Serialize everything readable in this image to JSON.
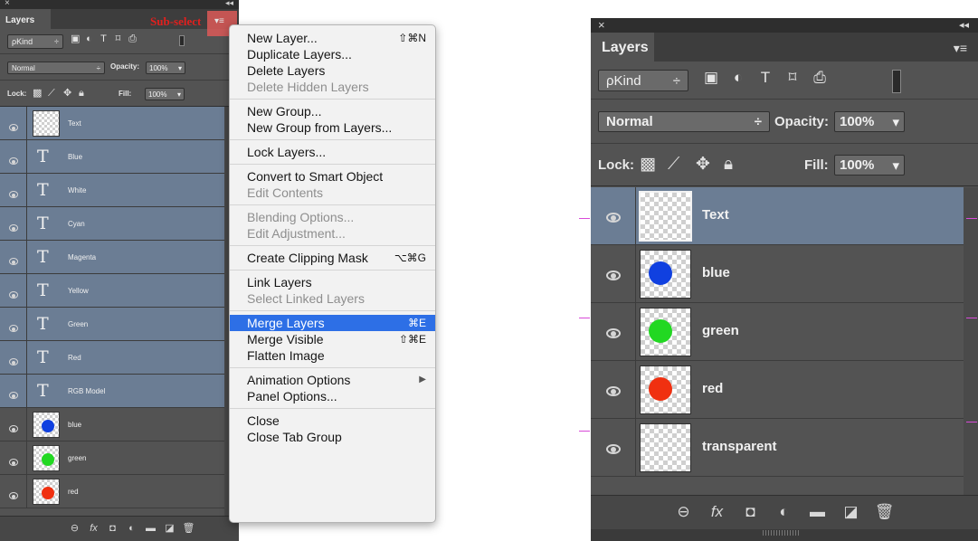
{
  "left_panel": {
    "close_glyph": "×",
    "collapse_glyph": "◂◂",
    "tab_label": "Layers",
    "annotation": "Sub-select",
    "panel_menu_glyph": "▾≡",
    "filter_kind": "ρKind",
    "filter_kind_arrow": "÷",
    "filter_icons": [
      "image-icon",
      "adjustment-icon",
      "type-icon",
      "shape-icon",
      "smart-object-icon"
    ],
    "blend_mode": "Normal",
    "blend_arrow": "÷",
    "opacity_label": "Opacity:",
    "opacity_value": "100%",
    "lock_label": "Lock:",
    "fill_label": "Fill:",
    "fill_value": "100%",
    "layers": [
      {
        "name": "Text",
        "kind": "raster",
        "selected": true
      },
      {
        "name": "Blue",
        "kind": "type",
        "selected": true
      },
      {
        "name": "White",
        "kind": "type",
        "selected": true
      },
      {
        "name": "Cyan",
        "kind": "type",
        "selected": true
      },
      {
        "name": "Magenta",
        "kind": "type",
        "selected": true
      },
      {
        "name": "Yellow",
        "kind": "type",
        "selected": true
      },
      {
        "name": "Green",
        "kind": "type",
        "selected": true
      },
      {
        "name": "Red",
        "kind": "type",
        "selected": true
      },
      {
        "name": "RGB Model",
        "kind": "type",
        "selected": true
      },
      {
        "name": "blue",
        "kind": "dot",
        "color": "#1040e0",
        "selected": false
      },
      {
        "name": "green",
        "kind": "dot",
        "color": "#22d822",
        "selected": false
      },
      {
        "name": "red",
        "kind": "dot",
        "color": "#f03010",
        "selected": false
      }
    ],
    "type_glyph": "T",
    "bottom_icons": [
      "link-icon",
      "fx-icon",
      "mask-icon",
      "adjustment-layer-icon",
      "folder-icon",
      "new-layer-icon",
      "trash-icon"
    ]
  },
  "context_menu": {
    "items": [
      {
        "label": "New Layer...",
        "shortcut": "⇧⌘N",
        "disabled": false
      },
      {
        "label": "Duplicate Layers...",
        "disabled": false
      },
      {
        "label": "Delete Layers",
        "disabled": false
      },
      {
        "label": "Delete Hidden Layers",
        "disabled": true
      },
      {
        "sep": true
      },
      {
        "label": "New Group...",
        "disabled": false
      },
      {
        "label": "New Group from Layers...",
        "disabled": false
      },
      {
        "sep": true
      },
      {
        "label": "Lock Layers...",
        "disabled": false
      },
      {
        "sep": true
      },
      {
        "label": "Convert to Smart Object",
        "disabled": false
      },
      {
        "label": "Edit Contents",
        "disabled": true
      },
      {
        "sep": true
      },
      {
        "label": "Blending Options...",
        "disabled": true
      },
      {
        "label": "Edit Adjustment...",
        "disabled": true
      },
      {
        "sep": true
      },
      {
        "label": "Create Clipping Mask",
        "shortcut": "⌥⌘G",
        "disabled": false
      },
      {
        "sep": true
      },
      {
        "label": "Link Layers",
        "disabled": false
      },
      {
        "label": "Select Linked Layers",
        "disabled": true
      },
      {
        "sep": true
      },
      {
        "label": "Merge Layers",
        "shortcut": "⌘E",
        "disabled": false,
        "highlighted": true
      },
      {
        "label": "Merge Visible",
        "shortcut": "⇧⌘E",
        "disabled": false
      },
      {
        "label": "Flatten Image",
        "disabled": false
      },
      {
        "sep": true
      },
      {
        "label": "Animation Options",
        "submenu": true,
        "disabled": false
      },
      {
        "label": "Panel Options...",
        "disabled": false
      },
      {
        "sep": true
      },
      {
        "label": "Close",
        "disabled": false
      },
      {
        "label": "Close Tab Group",
        "disabled": false
      }
    ],
    "submenu_glyph": "▶"
  },
  "right_panel": {
    "close_glyph": "×",
    "collapse_glyph": "◂◂",
    "tab_label": "Layers",
    "panel_menu_glyph": "▾≡",
    "filter_kind": "ρKind",
    "filter_kind_arrow": "÷",
    "filter_icons": [
      "image-icon",
      "adjustment-icon",
      "type-icon",
      "shape-icon",
      "smart-object-icon"
    ],
    "blend_mode": "Normal",
    "blend_arrow": "÷",
    "opacity_label": "Opacity:",
    "opacity_value": "100%",
    "lock_label": "Lock:",
    "fill_label": "Fill:",
    "fill_value": "100%",
    "layers": [
      {
        "name": "Text",
        "kind": "raster",
        "selected": true
      },
      {
        "name": "blue",
        "kind": "dot",
        "color": "#1040e0",
        "selected": false
      },
      {
        "name": "green",
        "kind": "dot",
        "color": "#22d822",
        "selected": false
      },
      {
        "name": "red",
        "kind": "dot",
        "color": "#f03010",
        "selected": false
      },
      {
        "name": "transparent",
        "kind": "raster",
        "selected": false
      }
    ],
    "bottom_icons": [
      "link-icon",
      "fx-icon",
      "mask-icon",
      "adjustment-layer-icon",
      "folder-icon",
      "new-layer-icon",
      "trash-icon"
    ]
  },
  "colors": {
    "panel_bg": "#535353",
    "selected_row": "#6b7d94",
    "menu_highlight": "#2d6fe6",
    "annotation_red": "#e0201e",
    "guide_magenta": "#d84ad8"
  }
}
